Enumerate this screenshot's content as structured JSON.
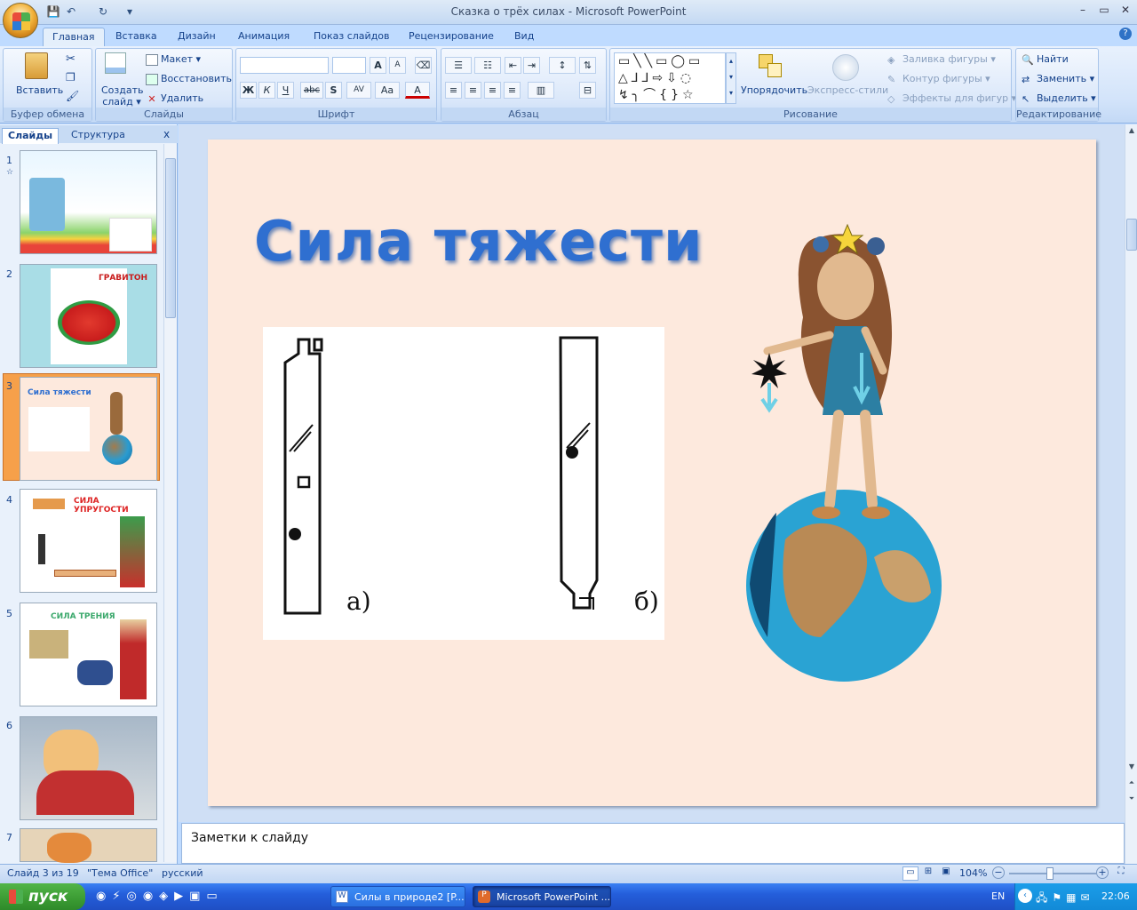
{
  "window": {
    "title": "Сказка о трёх силах - Microsoft PowerPoint"
  },
  "ribbon_tabs": [
    "Главная",
    "Вставка",
    "Дизайн",
    "Анимация",
    "Показ слайдов",
    "Рецензирование",
    "Вид"
  ],
  "ribbon": {
    "clipboard": {
      "label": "Буфер обмена",
      "paste": "Вставить"
    },
    "slides": {
      "label": "Слайды",
      "new_slide": "Создать слайд ▾",
      "layout": "Макет ▾",
      "reset": "Восстановить",
      "delete": "Удалить"
    },
    "font": {
      "label": "Шрифт",
      "bold": "Ж",
      "italic": "К",
      "underline": "Ч",
      "strike": "abc",
      "shadow": "S",
      "grow": "A",
      "shrink": "A",
      "case": "Aa",
      "color": "A"
    },
    "paragraph": {
      "label": "Абзац"
    },
    "drawing": {
      "label": "Рисование",
      "arrange": "Упорядочить",
      "quick_styles": "Экспресс-стили",
      "fill": "Заливка фигуры ▾",
      "outline": "Контур фигуры ▾",
      "effects": "Эффекты для фигур ▾"
    },
    "editing": {
      "label": "Редактирование",
      "find": "Найти",
      "replace": "Заменить ▾",
      "select": "Выделить ▾"
    }
  },
  "left_pane": {
    "tabs": [
      "Слайды",
      "Структура"
    ],
    "close": "x",
    "thumbnails": [
      {
        "num": "1",
        "text": ""
      },
      {
        "num": "2",
        "text": "ГРАВИТОН"
      },
      {
        "num": "3",
        "text": "Сила тяжести"
      },
      {
        "num": "4",
        "text": "СИЛА УПРУГОСТИ"
      },
      {
        "num": "5",
        "text": "СИЛА ТРЕНИЯ"
      },
      {
        "num": "6",
        "text": ""
      },
      {
        "num": "7",
        "text": ""
      }
    ]
  },
  "slide": {
    "title": "Сила тяжести",
    "figure_labels": [
      "а)",
      "б)"
    ]
  },
  "notes": {
    "text": "Заметки к слайду"
  },
  "status": {
    "slide": "Слайд 3 из 19",
    "theme": "\"Тема Office\"",
    "language": "русский",
    "zoom": "104%"
  },
  "taskbar": {
    "start": "пуск",
    "buttons": [
      "Силы в природе2 [P...",
      "Microsoft PowerPoint ..."
    ],
    "lang": "EN",
    "time": "22:06"
  },
  "colors": {
    "title_blue": "#2f6fd0",
    "slide_bg": "#fde9dd",
    "selected_thumb": "#f6a04a"
  }
}
